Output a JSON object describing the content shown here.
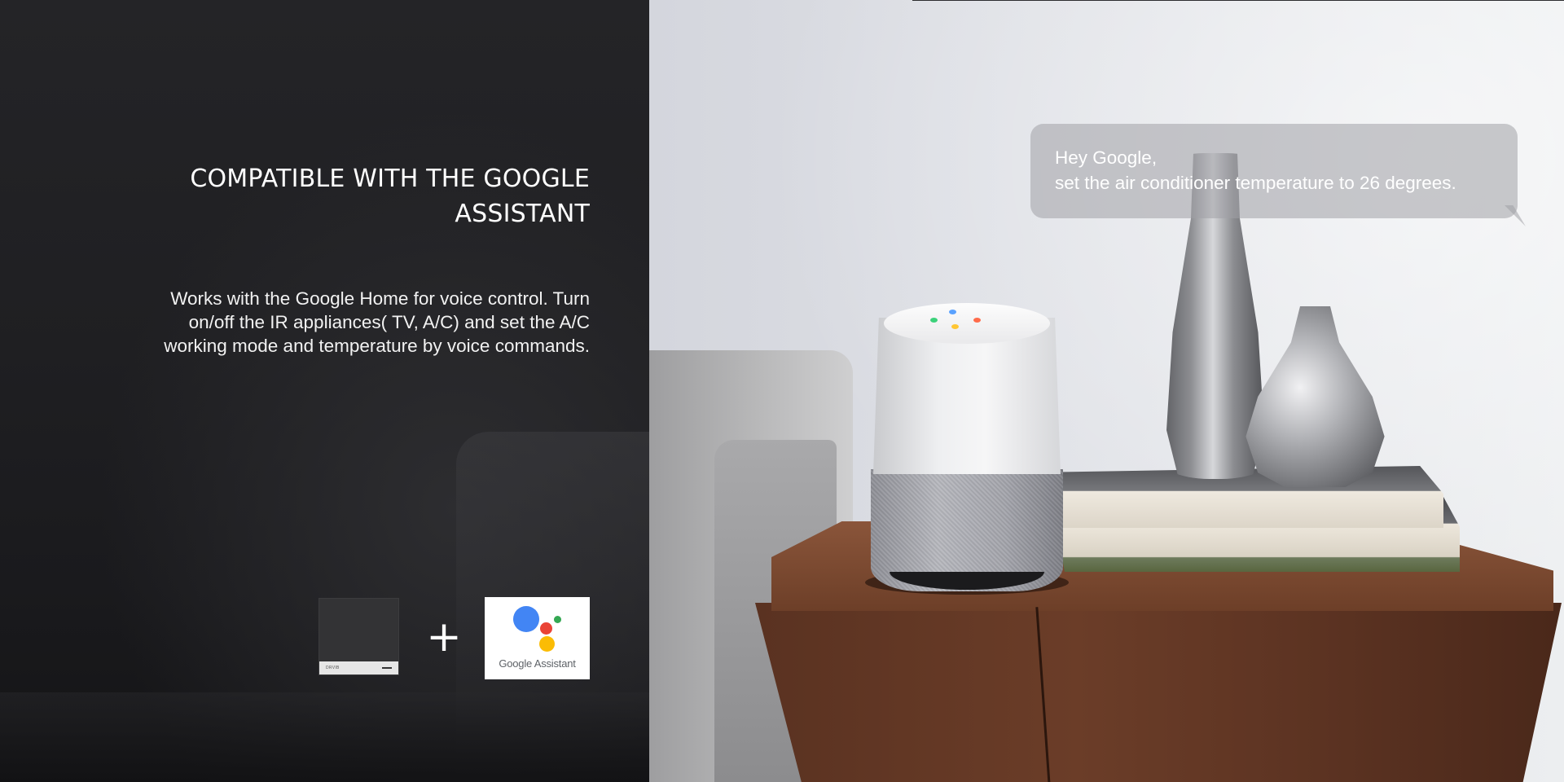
{
  "feature": {
    "headline_lines": [
      "COMPATIBLE WITH THE GOOGLE",
      "ASSISTANT"
    ],
    "description_lines": [
      "Works with the Google Home for voice control. Turn",
      "on/off the IR appliances( TV, A/C) and set the A/C",
      "working mode and temperature by voice commands."
    ]
  },
  "products": {
    "device_label": "DRVIB",
    "connector": "+",
    "assistant_logo_text": "Google Assistant",
    "logo_colors": {
      "blue": "#4285f4",
      "red": "#ea4335",
      "green": "#34a853",
      "yellow": "#fbbc04"
    }
  },
  "voice_command": {
    "line1": "Hey Google,",
    "line2": "set the air conditioner temperature to 26 degrees."
  },
  "colors": {
    "panel_background": "#1f1f22",
    "text": "#ffffff"
  }
}
